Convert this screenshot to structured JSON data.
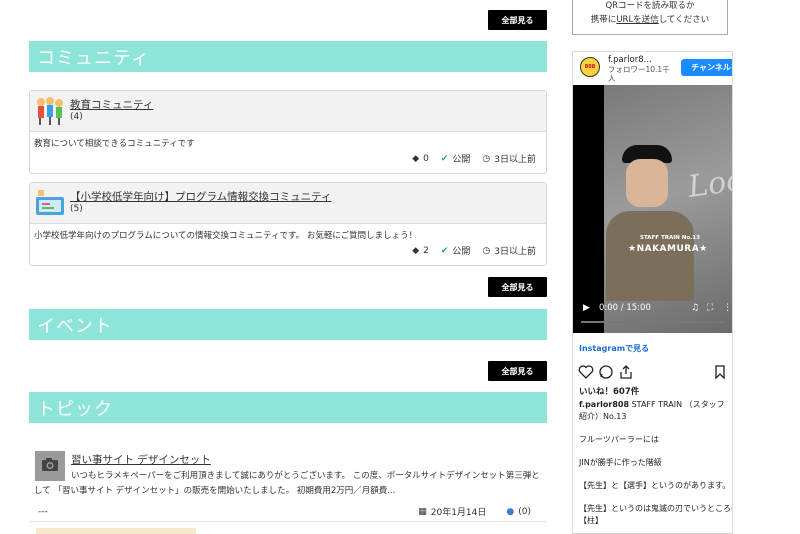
{
  "buttons": {
    "view_all": "全部見る"
  },
  "sections": {
    "community": "コミュニティ",
    "event": "イベント",
    "topic": "トピック"
  },
  "communities": [
    {
      "title": "教育コミュニティ",
      "count": "(4)",
      "description": "教育について相談できるコミュニティです",
      "tags": "0",
      "visibility": "公開",
      "updated": "3日以上前"
    },
    {
      "title": "【小学校低学年向け】プログラム情報交換コミュニティ",
      "count": "(5)",
      "description": "小学校低学年向けのプログラムについての情報交換コミュニティです。 お気軽にご質問しましょう！",
      "tags": "2",
      "visibility": "公開",
      "updated": "3日以上前"
    }
  ],
  "topic": {
    "title": "習い事サイト デザインセット",
    "body": "いつもヒラメキペーパーをご利用頂きまして誠にありがとうございます。 この度、ポータルサイトデザインセット第三弾として 「習い事サイト デザインセット」の販売を開始いたしました。 初期費用2万円／月額費...",
    "author": "---",
    "date": "20年1月14日",
    "comments": "(0)",
    "thumb_label": "NO IMAGE"
  },
  "sidebar": {
    "qr_line1": "QRコードを読み取るか",
    "qr_line2_prefix": "携帯に",
    "qr_link": "URLを送信",
    "qr_line2_suffix": "してください"
  },
  "instagram": {
    "avatar_text": "808",
    "username": "f.parlor8...",
    "followers": "フォロワー10.1千人",
    "channel_button": "チャンネルを見る",
    "overlay_title": "STAFF TRAIN No.13",
    "overlay_name": "★NAKAMURA★",
    "wall_text": "Loca",
    "video_time": "0:00 / 15:00",
    "view_link": "Instagramで見る",
    "likes": "いいね！607件",
    "caption_user": "f.parlor808",
    "caption_text": "STAFF TRAIN （スタッフ紹介）No.13",
    "lines": [
      "フルーツパーラーには",
      "JINが勝手に作った階級",
      "【先生】と【選手】というのがあります。",
      "【先生】というのは鬼滅の刃でいうところの",
      "【柱】"
    ]
  },
  "colors": {
    "section_bar": "#8de5d9",
    "button_bg": "#000000",
    "ig_button": "#1a8cff",
    "ig_link": "#1a6fd1",
    "public_check": "#27ae60"
  }
}
